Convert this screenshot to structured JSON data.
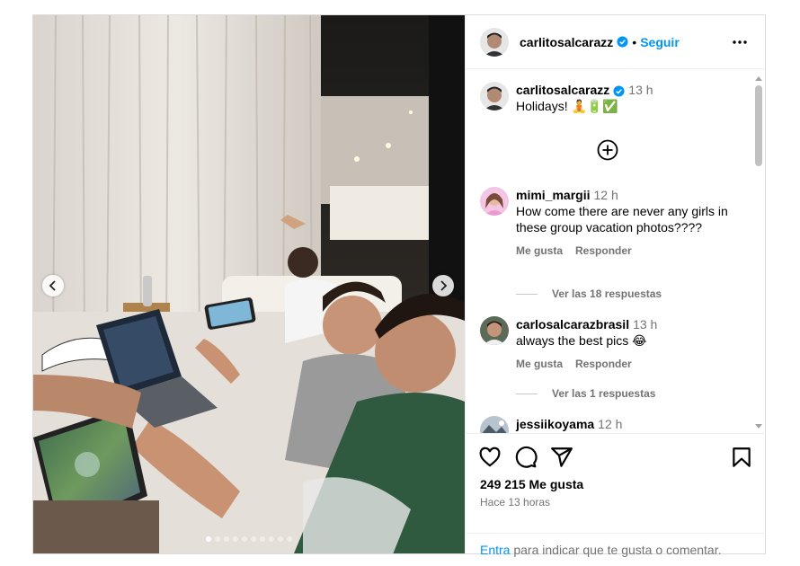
{
  "header": {
    "username": "carlitosalcarazz",
    "separator": "•",
    "follow_label": "Seguir"
  },
  "caption": {
    "username": "carlitosalcarazz",
    "time": "13 h",
    "text": "Holidays! 🧘🔋✅"
  },
  "comments": [
    {
      "username": "mimi_margii",
      "time": "12 h",
      "text": "How come there are never any girls in these group vacation photos????",
      "like_label": "Me gusta",
      "reply_label": "Responder",
      "view_replies": "Ver las 18 respuestas"
    },
    {
      "username": "carlosalcarazbrasil",
      "time": "13 h",
      "text": "always the best pics 😂",
      "like_label": "Me gusta",
      "reply_label": "Responder",
      "view_replies": "Ver las 1 respuestas"
    },
    {
      "username": "jessiikoyama",
      "time": "12 h",
      "text": "❤️❤️"
    }
  ],
  "footer": {
    "likes": "249 215 Me gusta",
    "posted": "Hace 13 horas",
    "login_link": "Entra",
    "login_rest": " para indicar que te gusta o comentar."
  },
  "carousel": {
    "count": 10,
    "active_index": 0
  },
  "colors": {
    "accent": "#0095f6",
    "verified": "#0095f6",
    "muted": "#737373"
  }
}
